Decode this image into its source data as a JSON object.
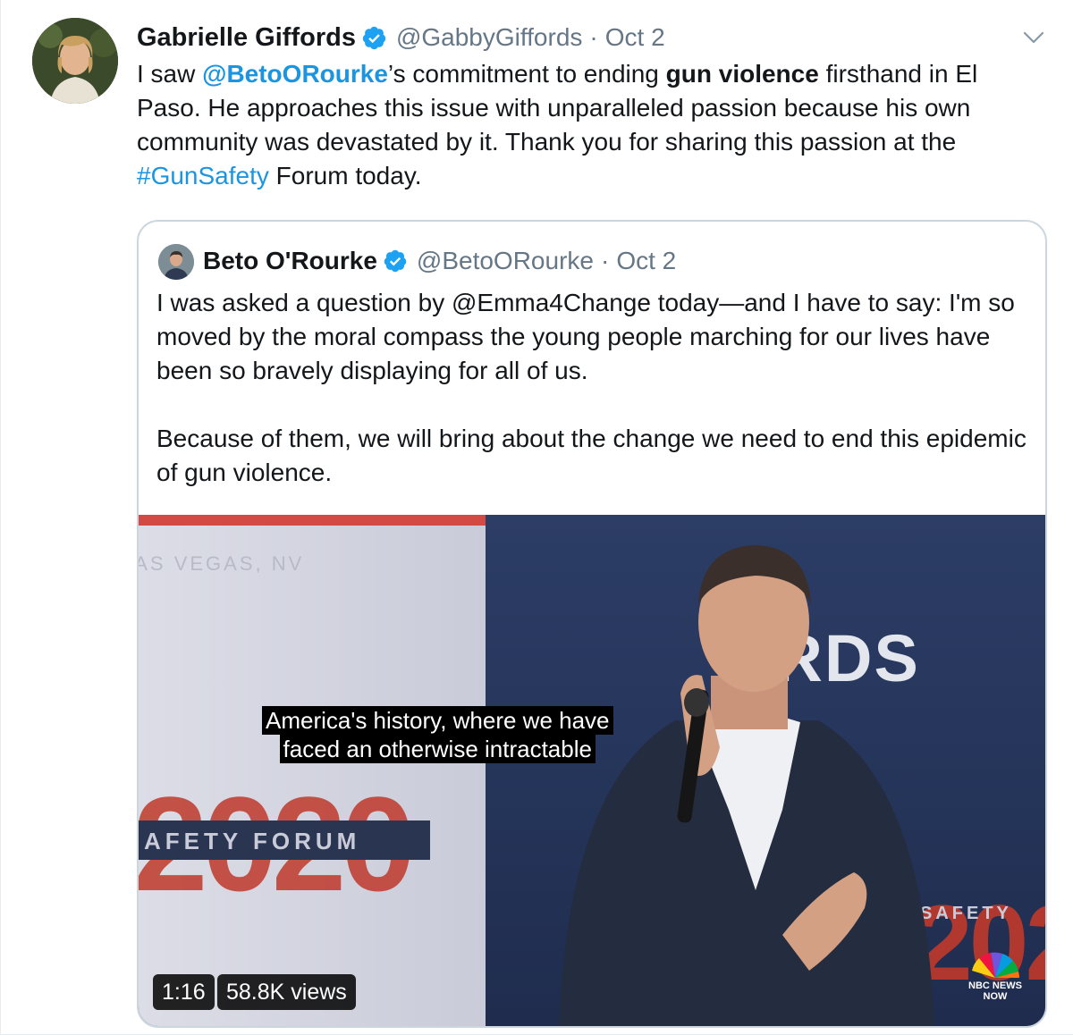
{
  "tweet": {
    "author_name": "Gabrielle Giffords",
    "handle": "@GabbyGiffords",
    "separator": "·",
    "date": "Oct 2",
    "text_parts": {
      "p1": "I saw ",
      "mention": "@BetoORourke",
      "p2": "’s commitment to ending ",
      "bold": "gun violence",
      "p3": " firsthand in El Paso. He approaches this issue with unparalleled passion because his own community was devastated by it. Thank you for sharing this passion at the ",
      "hashtag": "#GunSafety",
      "p4": " Forum today."
    }
  },
  "quote": {
    "author_name": "Beto O'Rourke",
    "handle": "@BetoORourke",
    "separator": "·",
    "date": "Oct 2",
    "paragraph1": "I was asked a question by @Emma4Change today—and I have to say: I'm so moved by the moral compass the young people marching for our lives have been so bravely displaying for all of us.",
    "paragraph2": "Because of them, we will bring about the change we need to end this epidemic of gun violence."
  },
  "video": {
    "caption_line1": "America's history, where we have",
    "caption_line2": "faced an otherwise intractable",
    "duration": "1:16",
    "views": "58.8K views",
    "backdrop_text_left_year": "2020",
    "backdrop_text_left_banner": "AFETY FORUM",
    "backdrop_text_right": "ORDS",
    "backdrop_text_right_year": "202",
    "backdrop_text_right_banner": "SAFETY",
    "backdrop_text_location": "LAS VEGAS, NV",
    "network_logo_line1": "NBC NEWS",
    "network_logo_line2": "NOW"
  },
  "colors": {
    "link": "#1b95e0",
    "secondary_text": "#657786",
    "border": "#ccd6dd"
  },
  "icons": {
    "verified": "verified-badge-icon",
    "menu": "chevron-down-icon",
    "network": "nbc-peacock-icon"
  }
}
